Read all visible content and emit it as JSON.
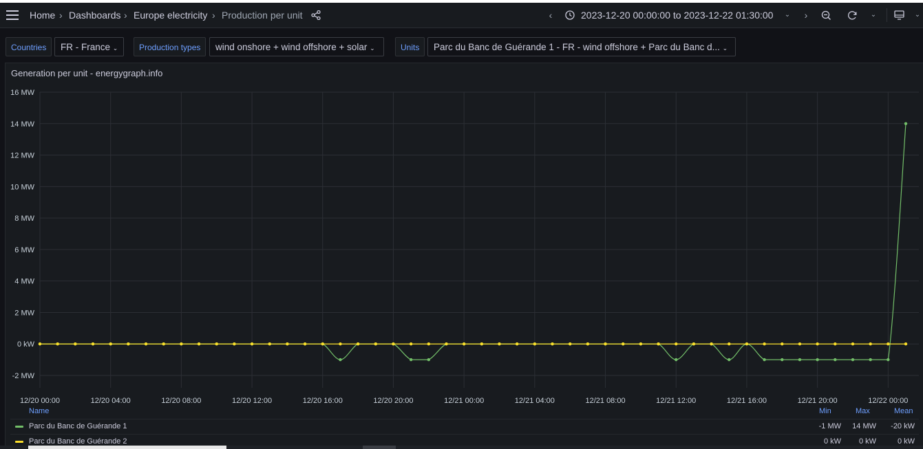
{
  "nav": {
    "breadcrumbs": [
      "Home",
      "Dashboards",
      "Europe electricity",
      "Production per unit"
    ],
    "time_range": "2023-12-20 00:00:00 to 2023-12-22 01:30:00",
    "icons": [
      "menu-icon",
      "share-icon",
      "chevron-left-icon",
      "clock-icon",
      "chevron-down-icon",
      "chevron-right-icon",
      "zoom-out-icon",
      "refresh-icon",
      "tv-mode-icon"
    ]
  },
  "variables": [
    {
      "label": "Countries",
      "value": "FR - France"
    },
    {
      "label": "Production types",
      "value": "wind onshore + wind offshore + solar"
    },
    {
      "label": "Units",
      "value": "Parc du Banc de Guérande 1 - FR - wind offshore + Parc du Banc d..."
    }
  ],
  "panel": {
    "title": "Generation per unit - energygraph.info"
  },
  "chart_data": {
    "type": "line",
    "yticks": [
      "16 MW",
      "14 MW",
      "12 MW",
      "10 MW",
      "8 MW",
      "6 MW",
      "4 MW",
      "2 MW",
      "0 kW",
      "-2 MW"
    ],
    "ylim": [
      -2,
      16
    ],
    "xticks": [
      "12/20 00:00",
      "12/20 04:00",
      "12/20 08:00",
      "12/20 12:00",
      "12/20 16:00",
      "12/20 20:00",
      "12/21 00:00",
      "12/21 04:00",
      "12/21 08:00",
      "12/21 12:00",
      "12/21 16:00",
      "12/21 20:00",
      "12/22 00:00"
    ],
    "x_hours": [
      0,
      1,
      2,
      3,
      4,
      5,
      6,
      7,
      8,
      9,
      10,
      11,
      12,
      13,
      14,
      15,
      16,
      17,
      18,
      19,
      20,
      21,
      22,
      23,
      24,
      25,
      26,
      27,
      28,
      29,
      30,
      31,
      32,
      33,
      34,
      35,
      36,
      37,
      38,
      39,
      40,
      41,
      42,
      43,
      44,
      45,
      46,
      47,
      48,
      49
    ],
    "grid": true,
    "series": [
      {
        "name": "Parc du Banc de Guérande 1",
        "color": "#73bf69",
        "values": [
          0,
          0,
          0,
          0,
          0,
          0,
          0,
          0,
          0,
          0,
          0,
          0,
          0,
          0,
          0,
          0,
          0,
          -1,
          0,
          0,
          0,
          -1,
          -1,
          0,
          0,
          0,
          0,
          0,
          0,
          0,
          0,
          0,
          0,
          0,
          0,
          0,
          -1,
          0,
          0,
          -1,
          0,
          -1,
          -1,
          -1,
          -1,
          -1,
          -1,
          -1,
          -1,
          14
        ]
      },
      {
        "name": "Parc du Banc de Guérande 2",
        "color": "#fade2a",
        "values": [
          0,
          0,
          0,
          0,
          0,
          0,
          0,
          0,
          0,
          0,
          0,
          0,
          0,
          0,
          0,
          0,
          0,
          0,
          0,
          0,
          0,
          0,
          0,
          0,
          0,
          0,
          0,
          0,
          0,
          0,
          0,
          0,
          0,
          0,
          0,
          0,
          0,
          0,
          0,
          0,
          0,
          0,
          0,
          0,
          0,
          0,
          0,
          0,
          0,
          0
        ]
      }
    ]
  },
  "legend": {
    "headers": {
      "name": "Name",
      "min": "Min",
      "max": "Max",
      "mean": "Mean"
    },
    "rows": [
      {
        "name": "Parc du Banc de Guérande 1",
        "min": "-1 MW",
        "max": "14 MW",
        "mean": "-20 kW",
        "color": "#73bf69"
      },
      {
        "name": "Parc du Banc de Guérande 2",
        "min": "0 kW",
        "max": "0 kW",
        "mean": "0 kW",
        "color": "#fade2a"
      }
    ]
  }
}
